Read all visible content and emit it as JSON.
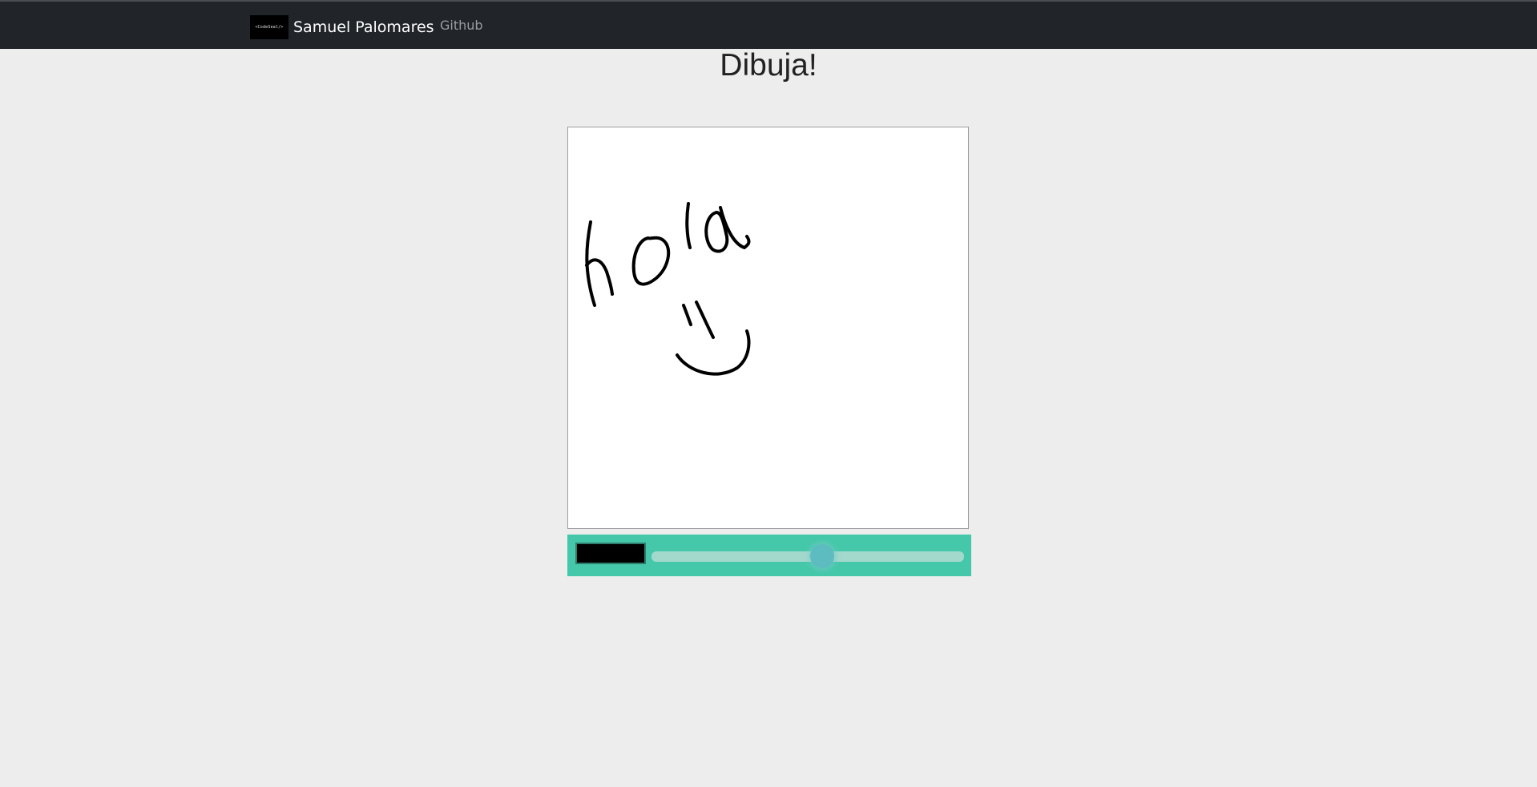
{
  "navbar": {
    "logo_text": "<CodeSeal/>",
    "brand_name": "Samuel Palomares",
    "links": [
      {
        "label": "Github"
      }
    ]
  },
  "main": {
    "title": "Dibuja!"
  },
  "toolbar": {
    "brush_color": "#000000",
    "brush_size_level": 0.55
  },
  "colors": {
    "navbar_bg": "#212529",
    "toolbar_bg": "#45c8aa",
    "page_bg": "#ededed"
  }
}
